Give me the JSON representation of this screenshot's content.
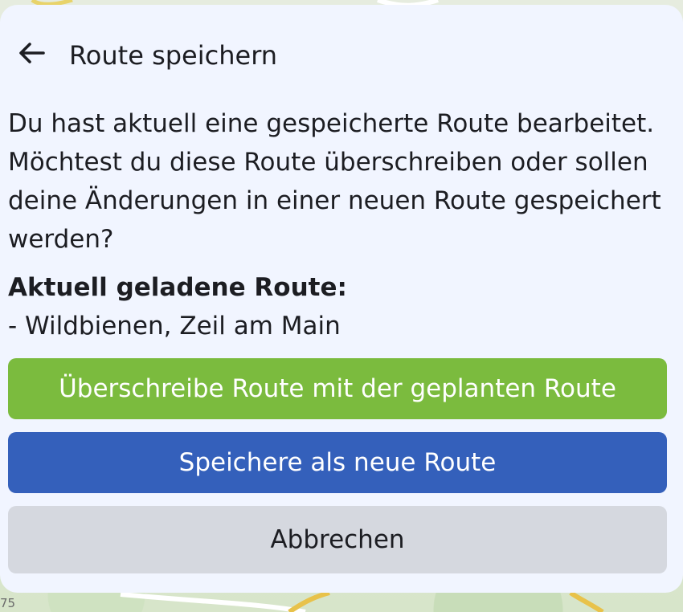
{
  "map": {
    "label": "75"
  },
  "dialog": {
    "title": "Route speichern",
    "back_icon": "arrow-left-icon",
    "message": "Du hast aktuell eine gespeicherte Route bearbeitet. Möchtest du diese Route überschreiben oder sollen deine Änderungen in einer neuen Route gespeichert werden?",
    "loaded_label": "Aktuell geladene Route:",
    "loaded_route": "- Wildbienen, Zeil am Main"
  },
  "buttons": {
    "overwrite": "Überschreibe Route mit der geplanten Route",
    "save_new": "Speichere als neue Route",
    "cancel": "Abbrechen"
  },
  "colors": {
    "sheet_background": "#f1f5ff",
    "overwrite_button": "#7bbb3e",
    "save_new_button": "#3460bb",
    "cancel_button": "#d5d8df",
    "text": "#1c1d22"
  }
}
